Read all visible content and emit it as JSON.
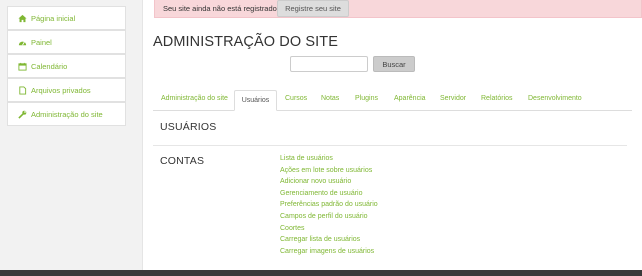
{
  "sidebar": {
    "items": [
      {
        "label": "Página inicial",
        "icon": "home-icon"
      },
      {
        "label": "Painel",
        "icon": "dashboard-icon"
      },
      {
        "label": "Calendário",
        "icon": "calendar-icon"
      },
      {
        "label": "Arquivos privados",
        "icon": "file-icon"
      },
      {
        "label": "Administração do site",
        "icon": "wrench-icon"
      }
    ]
  },
  "alert": {
    "text": "Seu site ainda não está registrado.",
    "help_icon": "?",
    "button_label": "Registre seu site"
  },
  "page": {
    "title": "ADMINISTRAÇÃO DO SITE"
  },
  "search": {
    "value": "",
    "button_label": "Buscar"
  },
  "tabs": [
    {
      "label": "Administração do site",
      "active": false
    },
    {
      "label": "Usuários",
      "active": true
    },
    {
      "label": "Cursos",
      "active": false
    },
    {
      "label": "Notas",
      "active": false
    },
    {
      "label": "Plugins",
      "active": false
    },
    {
      "label": "Aparência",
      "active": false
    },
    {
      "label": "Servidor",
      "active": false
    },
    {
      "label": "Relatórios",
      "active": false
    },
    {
      "label": "Desenvolvimento",
      "active": false
    }
  ],
  "section": {
    "title": "USUÁRIOS"
  },
  "contas": {
    "title": "CONTAS",
    "links": [
      "Lista de usuários",
      "Ações em lote sobre usuários",
      "Adicionar novo usuário",
      "Gerenciamento de usuário",
      "Preferências padrão do usuário",
      "Campos de perfil do usuário",
      "Coortes",
      "Carregar lista de usuários",
      "Carregar imagens de usuários"
    ]
  },
  "colors": {
    "link": "#7fb733",
    "alert_bg": "#f8d7da",
    "text": "#333333"
  }
}
